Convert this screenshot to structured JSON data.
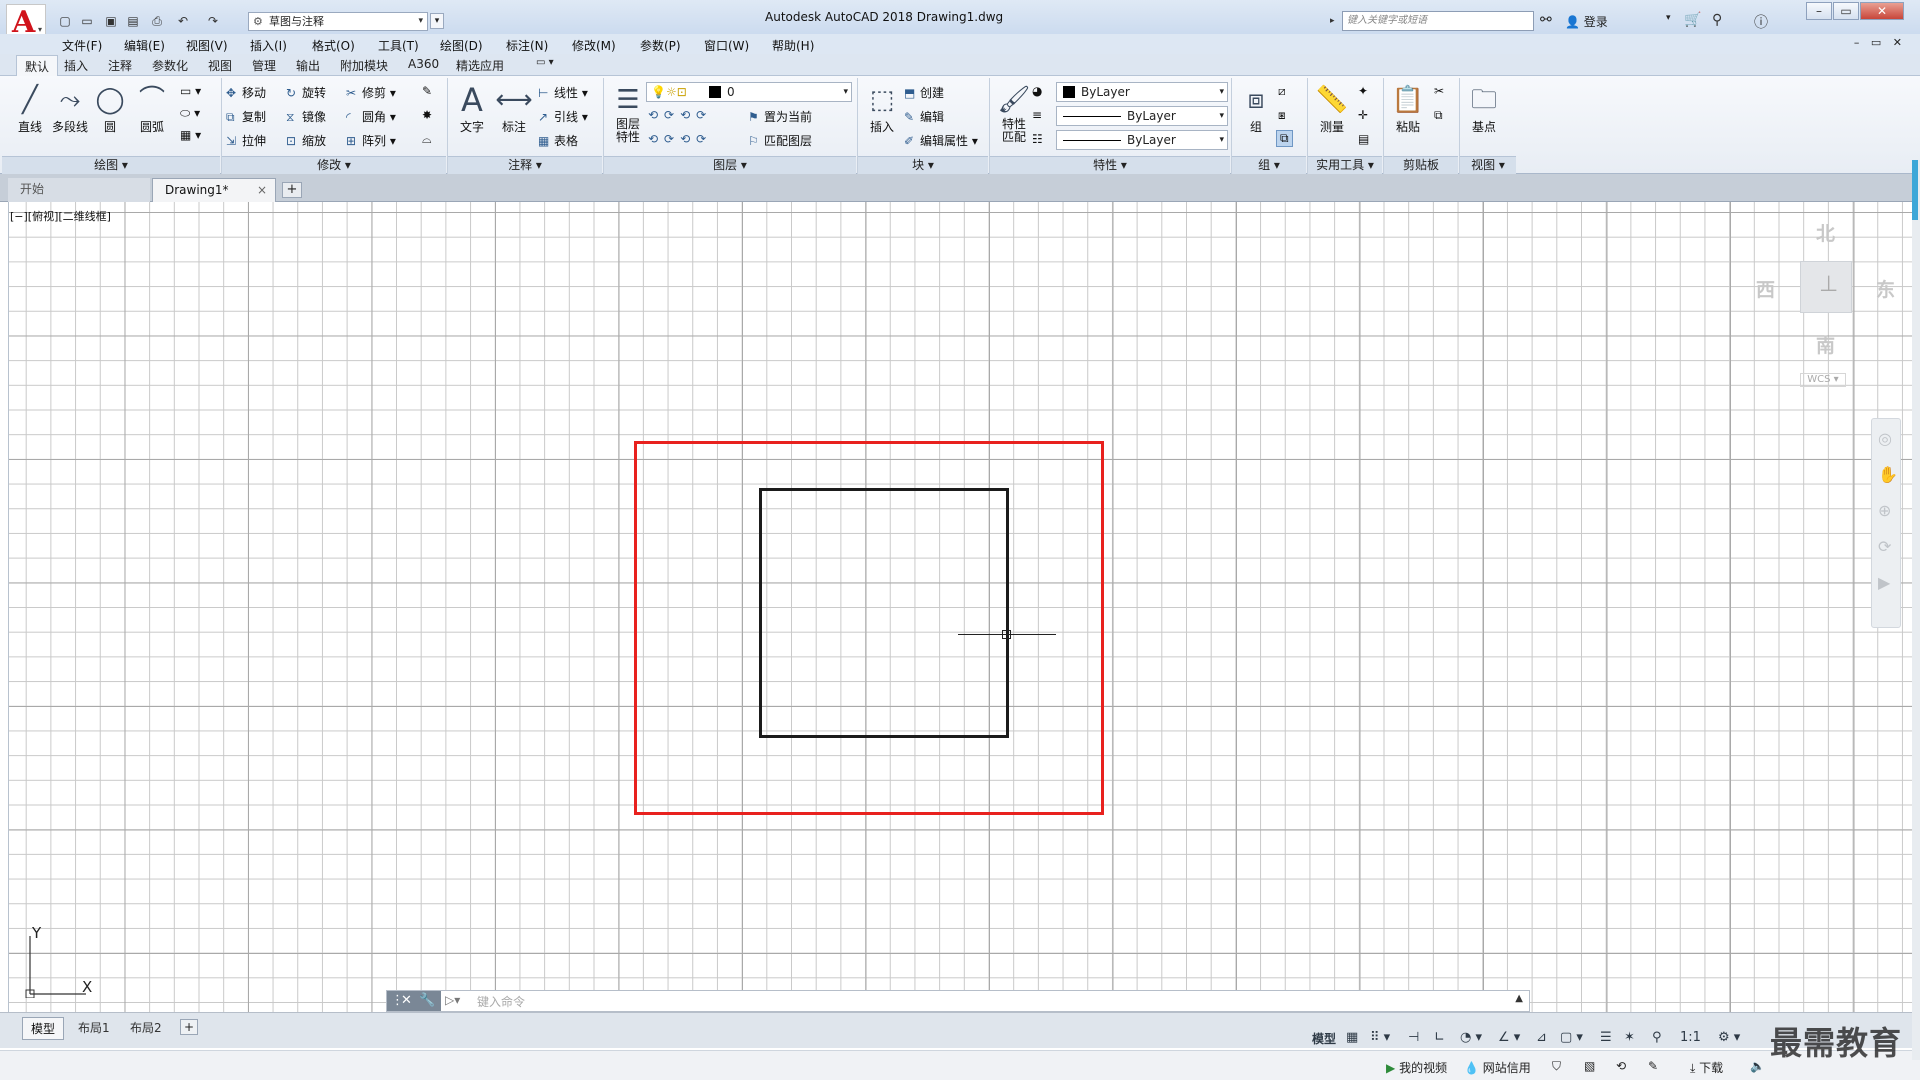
{
  "app": {
    "logo_letter": "A",
    "window_title": "Autodesk AutoCAD 2018    Drawing1.dwg",
    "workspace": "草图与注释",
    "search_placeholder": "键入关键字或短语",
    "login_label": "登录"
  },
  "menubar": {
    "items": [
      "文件(F)",
      "编辑(E)",
      "视图(V)",
      "插入(I)",
      "格式(O)",
      "工具(T)",
      "绘图(D)",
      "标注(N)",
      "修改(M)",
      "参数(P)",
      "窗口(W)",
      "帮助(H)"
    ]
  },
  "ribbon_tabs": [
    "默认",
    "插入",
    "注释",
    "参数化",
    "视图",
    "管理",
    "输出",
    "附加模块",
    "A360",
    "精选应用"
  ],
  "ribbon": {
    "draw": {
      "line": "直线",
      "polyline": "多段线",
      "circle": "圆",
      "arc": "圆弧",
      "footer": "绘图 ▾"
    },
    "modify": {
      "move": "移动",
      "rotate": "旋转",
      "trim": "修剪",
      "copy": "复制",
      "mirror": "镜像",
      "fillet": "圆角",
      "stretch": "拉伸",
      "scale": "缩放",
      "array": "阵列",
      "footer": "修改 ▾"
    },
    "annotation": {
      "text": "文字",
      "dimension": "标注",
      "linear": "线性",
      "leader": "引线",
      "table": "表格",
      "footer": "注释 ▾"
    },
    "layers": {
      "layer_props": "图层\n特性",
      "layer_value": "0",
      "set_current": "置为当前",
      "match_layer": "匹配图层",
      "footer": "图层 ▾"
    },
    "block": {
      "insert": "插入",
      "create": "创建",
      "edit": "编辑",
      "edit_attr": "编辑属性",
      "footer": "块 ▾"
    },
    "properties": {
      "match": "特性\n匹配",
      "color": "ByLayer",
      "linetype": "ByLayer",
      "lineweight": "ByLayer",
      "footer": "特性 ▾"
    },
    "groups": {
      "group": "组",
      "footer": "组 ▾"
    },
    "utilities": {
      "measure": "测量",
      "footer": "实用工具 ▾"
    },
    "clipboard": {
      "paste": "粘贴",
      "footer": "剪贴板"
    },
    "view": {
      "base": "基点",
      "footer": "视图 ▾"
    }
  },
  "doc_tabs": {
    "start": "开始",
    "drawing": "Drawing1*",
    "close": "×",
    "add": "+"
  },
  "viewport": {
    "label": "[−][俯视][二维线框]"
  },
  "viewcube": {
    "north": "北",
    "south": "南",
    "east": "东",
    "west": "西",
    "wcs": "WCS ▾"
  },
  "ucs": {
    "x": "X",
    "y": "Y"
  },
  "command": {
    "placeholder": "键入命令",
    "prompt": "▷▾"
  },
  "layout_tabs": [
    "模型",
    "布局1",
    "布局2"
  ],
  "status": {
    "model": "模型",
    "scale": "1:1"
  },
  "taskbar": {
    "video": "我的视频",
    "credit": "网站信用",
    "download": "下载"
  },
  "watermark": "最需教育",
  "colors": {
    "frame": "#e8211e",
    "rect": "#1b1b1b",
    "grid": "#c9c9c9",
    "logo": "#d0131b"
  }
}
